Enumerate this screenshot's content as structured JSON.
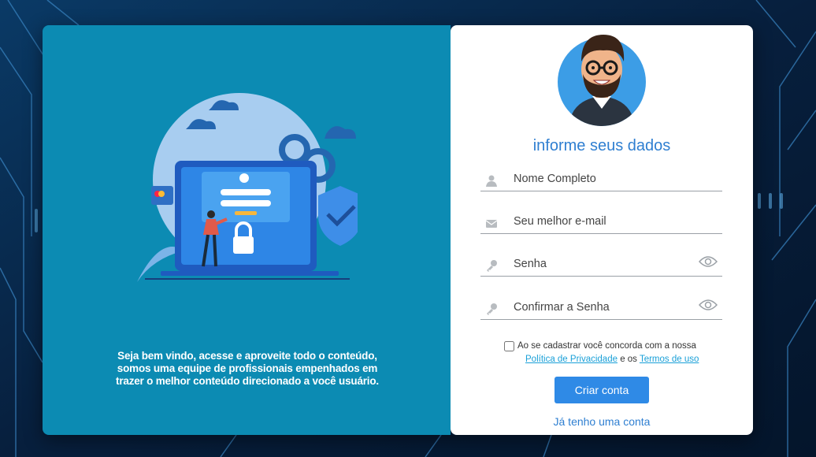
{
  "colors": {
    "left_panel": "#0c8bb3",
    "accent": "#2f8ae6",
    "title": "#2f7fd1",
    "link": "#1aa0d8"
  },
  "welcome_text": "Seja bem vindo, acesse e aproveite todo o conteúdo, somos uma equipe de profissionais empenhados em trazer o melhor conteúdo direcionado a você usuário.",
  "form": {
    "title": "informe seus dados",
    "fields": [
      {
        "placeholder": "Nome Completo",
        "icon": "user-icon"
      },
      {
        "placeholder": "Seu melhor e-mail",
        "icon": "envelope-icon"
      },
      {
        "placeholder": "Senha",
        "icon": "key-icon",
        "toggle": "eye-icon"
      },
      {
        "placeholder": "Confirmar a Senha",
        "icon": "key-icon",
        "toggle": "eye-icon"
      }
    ],
    "agree_text": "Ao se cadastrar você concorda com a nossa",
    "privacy_link": "Política de Privacidade",
    "and_text": "e os",
    "terms_link": "Termos de uso",
    "submit_label": "Criar conta",
    "login_link": "Já tenho uma conta"
  }
}
